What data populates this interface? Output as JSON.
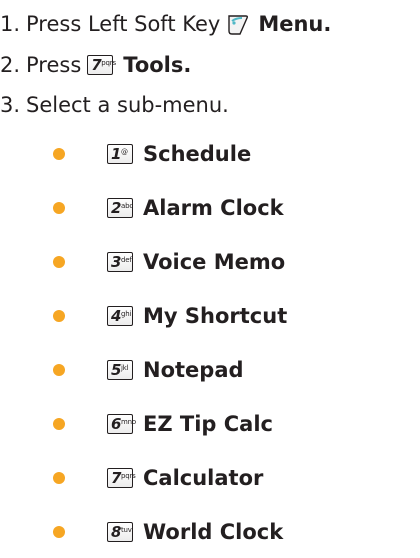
{
  "steps": [
    {
      "number": "1.",
      "text": "Press Left Soft Key",
      "action": "Menu."
    },
    {
      "number": "2.",
      "text": "Press",
      "key_digit": "7",
      "key_letters": "pqrs",
      "action": "Tools."
    },
    {
      "number": "3.",
      "text": "Select a sub-menu."
    }
  ],
  "submenu": [
    {
      "digit": "1",
      "letters": "@",
      "label": "Schedule"
    },
    {
      "digit": "2",
      "letters": "abc",
      "label": "Alarm Clock"
    },
    {
      "digit": "3",
      "letters": "def",
      "label": "Voice Memo"
    },
    {
      "digit": "4",
      "letters": "ghi",
      "label": "My Shortcut"
    },
    {
      "digit": "5",
      "letters": "jkl",
      "label": "Notepad"
    },
    {
      "digit": "6",
      "letters": "mno",
      "label": "EZ Tip Calc"
    },
    {
      "digit": "7",
      "letters": "pqrs",
      "label": "Calculator"
    },
    {
      "digit": "8",
      "letters": "tuv",
      "label": "World Clock"
    }
  ],
  "colors": {
    "bullet": "#f6a623",
    "text": "#231f20",
    "softkey_accent": "#4fb8c6"
  }
}
